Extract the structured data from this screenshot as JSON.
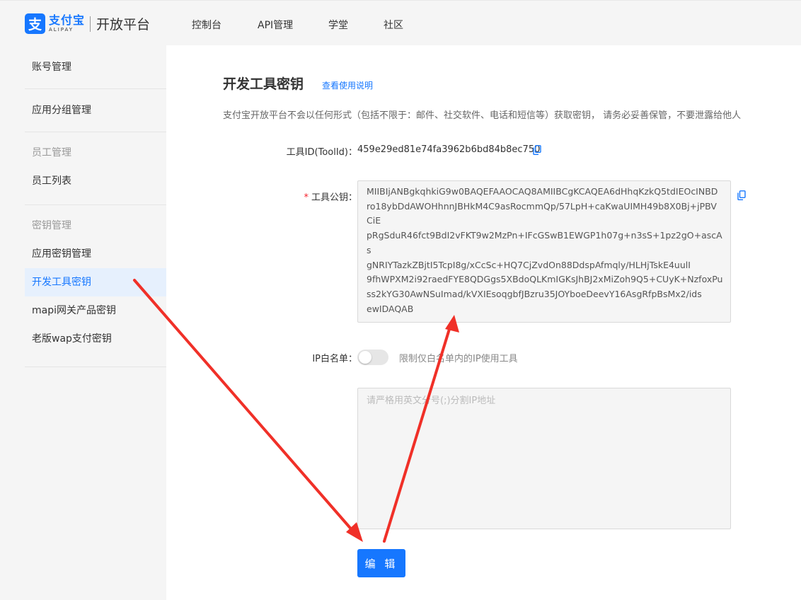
{
  "header": {
    "logo_mark": "支",
    "logo_cn": "支付宝",
    "logo_en": "ALIPAY",
    "platform": "开放平台",
    "nav": [
      "控制台",
      "API管理",
      "学堂",
      "社区"
    ]
  },
  "sidebar": {
    "items": [
      {
        "label": "账号管理"
      },
      {
        "label": "应用分组管理"
      },
      {
        "label": "员工管理"
      },
      {
        "label": "员工列表"
      },
      {
        "label": "密钥管理"
      },
      {
        "label": "应用密钥管理"
      },
      {
        "label": "开发工具密钥"
      },
      {
        "label": "mapi网关产品密钥"
      },
      {
        "label": "老版wap支付密钥"
      }
    ]
  },
  "main": {
    "title": "开发工具密钥",
    "help_link": "查看使用说明",
    "notice": "支付宝开放平台不会以任何形式（包括不限于：邮件、社交软件、电话和短信等）获取密钥， 请务必妥善保管，不要泄露给他人",
    "tool_id_label": "工具ID(ToolId)：",
    "tool_id_value": "459e29ed81e74fa3962b6bd84b8ec750",
    "required_mark": "*",
    "pubkey_label": "工具公钥：",
    "pubkey_lines": [
      "MIIBIjANBgkqhkiG9w0BAQEFAAOCAQ8AMIIBCgKCAQEA6dHhqKzkQ5tdIEOcINBD",
      "ro18ybDdAWOHhnnJBHkM4C9asRocmmQp/57LpH+caKwaUIMH49b8X0Bj+jPBV",
      "CiE",
      "pRgSduR46fct9BdI2vFKT9w2MzPn+IFcGSwB1EWGP1h07g+n3sS+1pz2gO+ascAs",
      "gNRIYTazkZBjtI5TcpI8g/xCcSc+HQ7CjZvdOn88DdspAfmqly/HLHjTskE4uulI",
      "9fhWPXM2i92raedFYE8QDGgs5XBdoQLKmIGKsJhBJ2xMiZoh9Q5+CUyK+NzfoxPu",
      "ss2kYG30AwNSuImad/kVXIEsoqgbfJBzru35JOYboeDeevY16AsgRfpBsMx2/ids",
      "ewIDAQAB"
    ],
    "ip_label": "IP白名单：",
    "ip_toggle_on": false,
    "ip_hint": "限制仅白名单内的IP使用工具",
    "ip_placeholder": "请严格用英文分号(;)分割IP地址",
    "edit_button": "编 辑"
  },
  "colors": {
    "brand": "#1677ff",
    "arrow": "#f03028"
  }
}
